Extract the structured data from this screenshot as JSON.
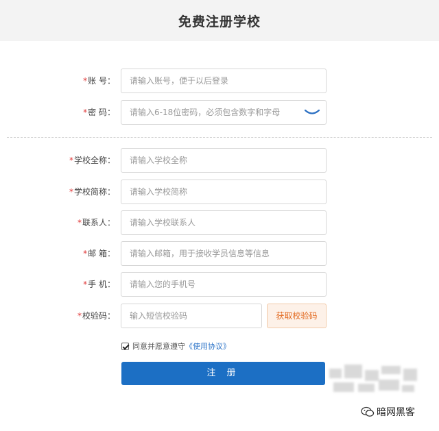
{
  "header": {
    "title": "免费注册学校"
  },
  "form": {
    "account": {
      "star": "*",
      "label": "账 号：",
      "placeholder": "请输入账号，便于以后登录"
    },
    "password": {
      "star": "*",
      "label": "密 码：",
      "placeholder": "请输入6-18位密码，必须包含数字和字母",
      "eye_icon": "eye-closed-icon"
    },
    "school_full": {
      "star": "*",
      "label": "学校全称：",
      "placeholder": "请输入学校全称"
    },
    "school_short": {
      "star": "*",
      "label": "学校简称：",
      "placeholder": "请输入学校简称"
    },
    "contact": {
      "star": "*",
      "label": "联系人：",
      "placeholder": "请输入学校联系人"
    },
    "email": {
      "star": "*",
      "label": "邮 箱：",
      "placeholder": "请输入邮箱，用于接收学员信息等信息"
    },
    "phone": {
      "star": "*",
      "label": "手 机：",
      "placeholder": "请输入您的手机号"
    },
    "sms_code": {
      "star": "*",
      "label": "校验码：",
      "placeholder": "输入短信校验码",
      "button": "获取校验码"
    },
    "agreement": {
      "checked": true,
      "text": "同意并愿意遵守",
      "link": "《使用协议》"
    },
    "submit": {
      "label": "注 册"
    }
  },
  "watermark": {
    "text": "暗网黑客",
    "icon": "wechat-icon"
  },
  "colors": {
    "primary": "#1c6fc4",
    "required": "#e03a3a",
    "code_button": "#e36b22",
    "link": "#2b73c8"
  }
}
